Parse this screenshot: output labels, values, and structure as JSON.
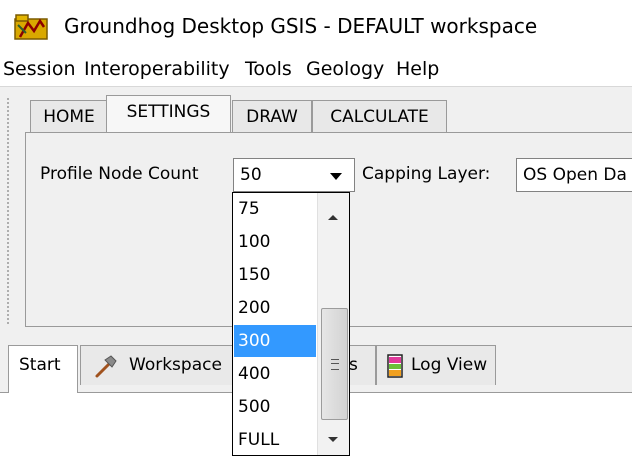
{
  "window": {
    "title": "Groundhog Desktop GSIS - DEFAULT workspace",
    "app_icon": "folder-map-icon"
  },
  "menu": [
    "Session",
    "Interoperability",
    "Tools",
    "Geology",
    "Help"
  ],
  "tabs": [
    {
      "label": "HOME"
    },
    {
      "label": "SETTINGS",
      "active": true
    },
    {
      "label": "DRAW"
    },
    {
      "label": "CALCULATE"
    }
  ],
  "settings": {
    "profile_node_count_label": "Profile Node Count",
    "profile_node_count_value": "50",
    "capping_layer_label": "Capping Layer:",
    "capping_layer_value": "OS Open Da"
  },
  "dropdown": {
    "options": [
      "75",
      "100",
      "150",
      "200",
      "300",
      "400",
      "500",
      "FULL"
    ],
    "selected": "300",
    "highlight_color": "#3399ff"
  },
  "bottom_tabs": [
    {
      "label": "Start",
      "active": true
    },
    {
      "label": "Workspace",
      "icon": "hammer-icon"
    },
    {
      "label": "s"
    },
    {
      "label": "Log View",
      "icon": "log-icon"
    }
  ]
}
